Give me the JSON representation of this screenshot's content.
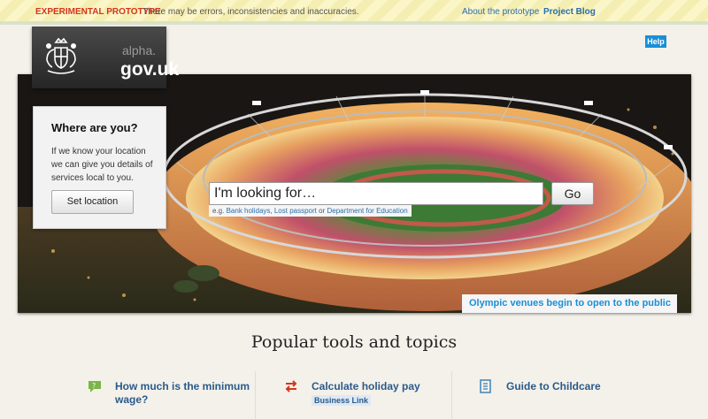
{
  "banner": {
    "label": "EXPERIMENTAL PROTOTYPE",
    "message": "There may be errors, inconsistencies and inaccuracies.",
    "about_link": "About the prototype",
    "blog_link": "Project Blog"
  },
  "logo": {
    "alpha": "alpha.",
    "site": "gov.uk"
  },
  "help_label": "Help",
  "location": {
    "title": "Where are you?",
    "text": "If we know your location we can give you details of services local to you.",
    "button": "Set location"
  },
  "search": {
    "value": "I'm looking for…",
    "go": "Go",
    "eg_prefix": "e.g.",
    "example1": "Bank holidays",
    "sep": ",",
    "example2": "Lost passport",
    "or": "or",
    "example3": "Department for Education"
  },
  "hero_caption": "Olympic venues begin to open to the public",
  "popular_title": "Popular tools and topics",
  "tools": [
    {
      "label_line1": "How much is the minimum",
      "label_line2": "wage?",
      "icon": "speech-bubble-icon",
      "color": "#7ab648"
    },
    {
      "label_line1": "Calculate holiday pay",
      "badge": "Business Link",
      "icon": "exchange-arrows-icon",
      "color": "#d4351c"
    },
    {
      "label_line1": "Guide to Childcare",
      "icon": "document-icon",
      "color": "#4a8ab8"
    }
  ]
}
